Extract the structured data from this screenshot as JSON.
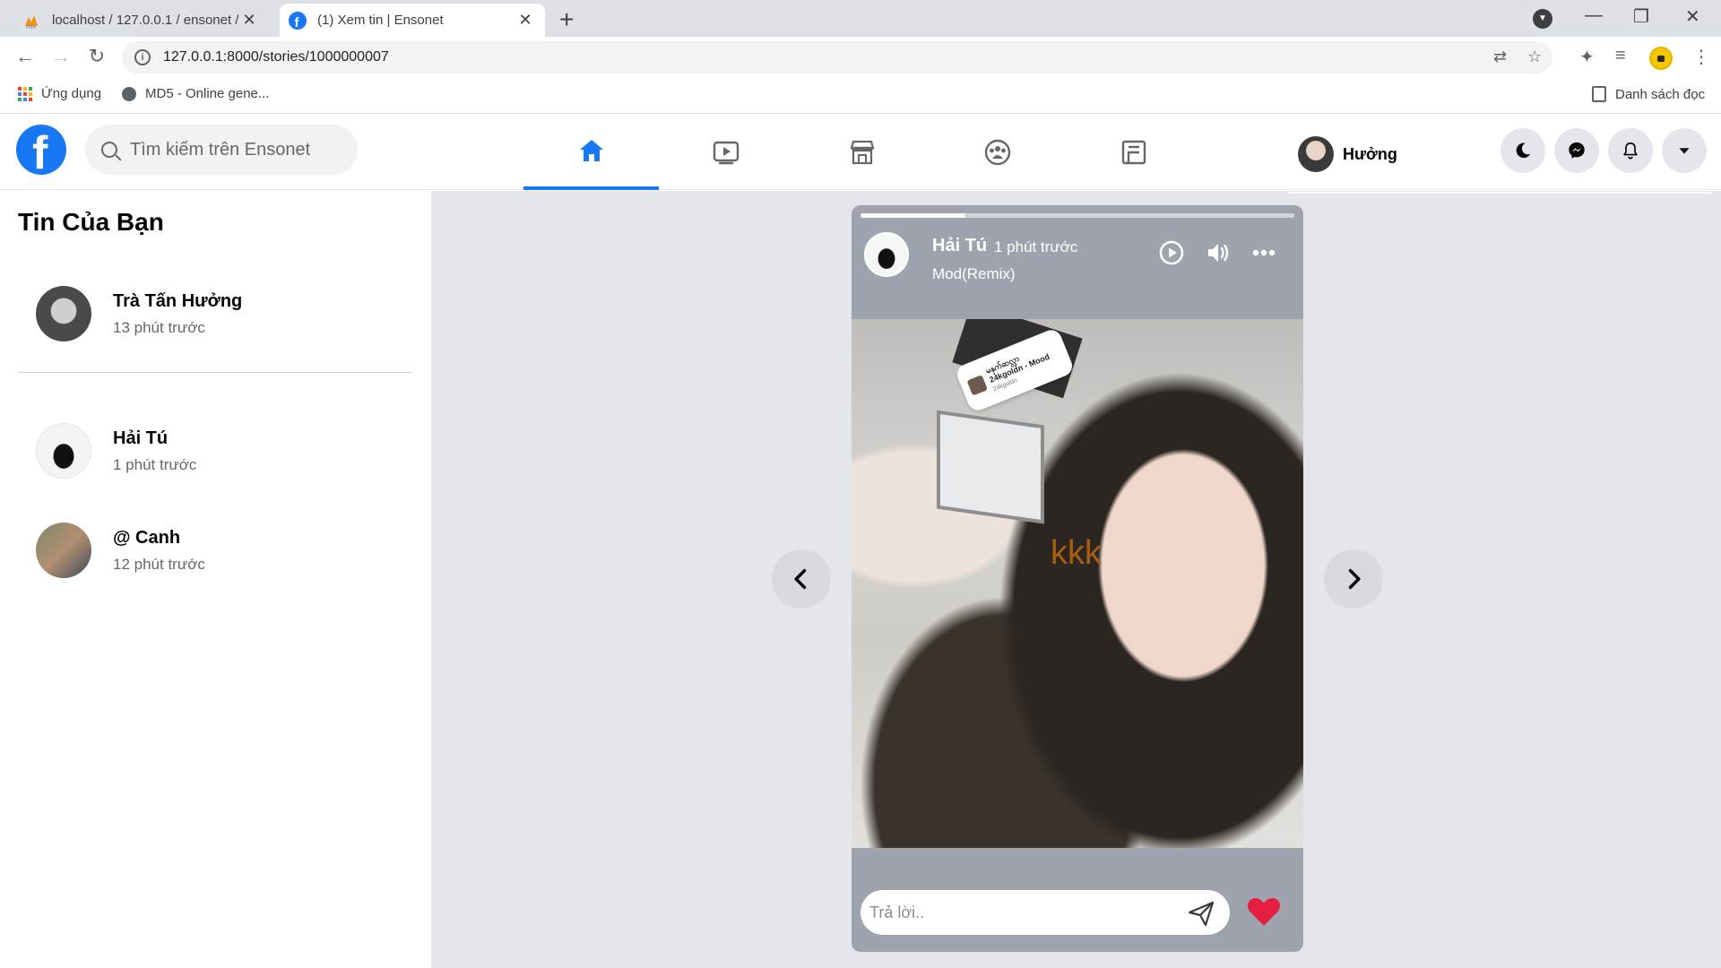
{
  "browser": {
    "tabs": [
      {
        "title": "localhost / 127.0.0.1 / ensonet / ",
        "active": false,
        "favicon": "phpmyadmin-icon"
      },
      {
        "title": "(1) Xem tin | Ensonet",
        "active": true,
        "favicon": "facebook-icon"
      }
    ],
    "url": "127.0.0.1:8000/stories/1000000007",
    "bookmarks": [
      {
        "label": "Ứng dụng",
        "icon": "apps-grid-icon"
      },
      {
        "label": "MD5 - Online gene...",
        "icon": "globe-icon"
      }
    ],
    "reading_list_label": "Danh sách đọc"
  },
  "header": {
    "search_placeholder": "Tìm kiếm trên Ensonet",
    "user_name": "Hưởng",
    "nav_items": [
      "home",
      "watch",
      "marketplace",
      "groups",
      "gaming"
    ],
    "active_nav": "home",
    "accent_color": "#1877f2"
  },
  "sidebar": {
    "title": "Tin Của Bạn",
    "my_story": {
      "name": "Trà Tấn Hưởng",
      "time": "13 phút trước"
    },
    "stories": [
      {
        "name": "Hải Tú",
        "time": "1 phút trước"
      },
      {
        "name": "@ Canh",
        "time": "12 phút trước"
      }
    ]
  },
  "story": {
    "author": "Hải Tú",
    "time": "1 phút trước",
    "music": "Mod(Remix)",
    "caption": "kkk",
    "progress": 0.24,
    "sticker": {
      "line1": "မနှက်ဆလ္လာ",
      "line2": "24kgoldn - Mood",
      "line3": "24kgoldn"
    },
    "reply_placeholder": "Trả lời..",
    "heart_color": "#e41e3f"
  }
}
